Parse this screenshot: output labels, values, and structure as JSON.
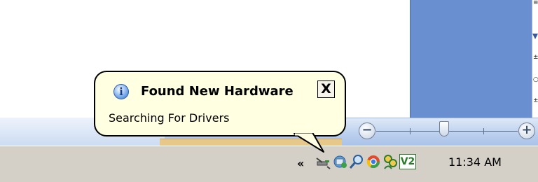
{
  "notification": {
    "title": "Found New Hardware",
    "message": "Searching For Drivers",
    "close_label": "X",
    "icon": "info-icon"
  },
  "zoom": {
    "minus_label": "−",
    "plus_label": "+"
  },
  "tray": {
    "expand_label": "«",
    "icons": [
      "hardware-plug-icon",
      "network-icon",
      "search-icon",
      "chrome-icon",
      "users-icon",
      "v2-icon"
    ],
    "v2_label": "V2",
    "clock": "11:34 AM"
  },
  "colors": {
    "balloon_bg": "#ffffe1",
    "taskbar_bg": "#d4d0c8",
    "window_blue": "#6a8fd0"
  }
}
